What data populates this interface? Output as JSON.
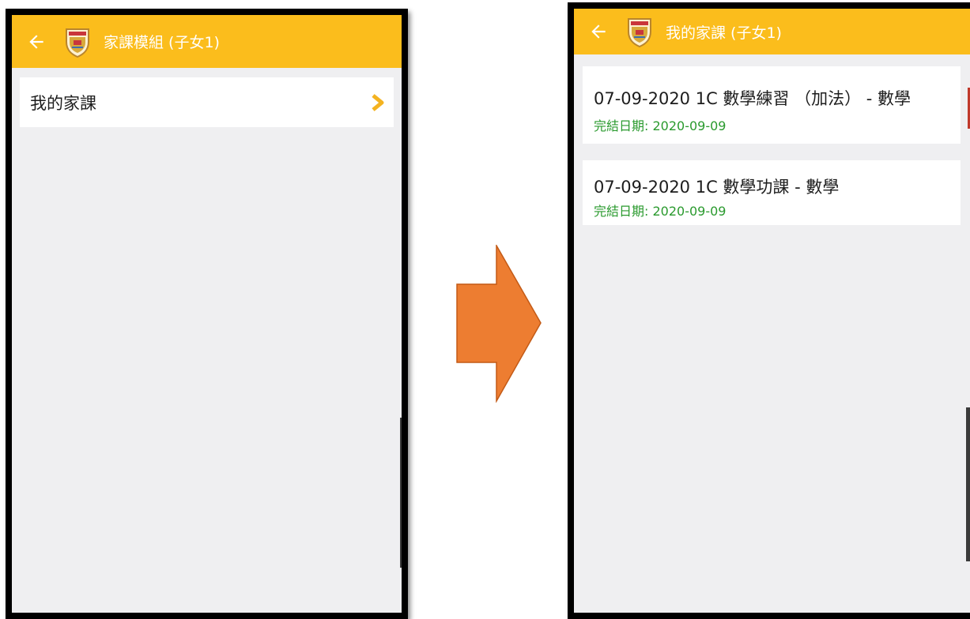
{
  "left_screen": {
    "appbar": {
      "title": "家課模組 (子女1)",
      "back_icon": "arrow-left-icon",
      "logo_icon": "school-crest-icon"
    },
    "menu": {
      "items": [
        {
          "label": "我的家課",
          "icon": "chevron-right-icon"
        }
      ]
    }
  },
  "transition": {
    "icon": "arrow-right-icon",
    "color": "#ed7d31"
  },
  "right_screen": {
    "appbar": {
      "title": "我的家課 (子女1)",
      "back_icon": "arrow-left-icon",
      "logo_icon": "school-crest-icon"
    },
    "homework": [
      {
        "title": "07-09-2020 1C 數學練習 （加法） - 數學",
        "due": "完結日期: 2020-09-09"
      },
      {
        "title": "07-09-2020 1C 數學功課 - 數學",
        "due": "完結日期: 2020-09-09"
      }
    ]
  },
  "colors": {
    "appbar": "#fbbd1c",
    "chevron": "#f4b320",
    "due_text": "#2a9a2e",
    "screen_bg": "#efeff1"
  }
}
